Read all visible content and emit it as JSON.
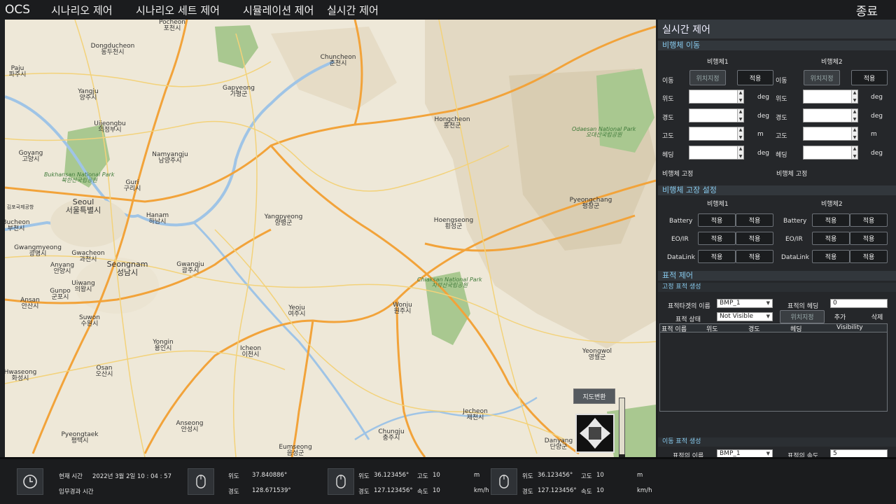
{
  "app": {
    "brand": "OCS",
    "menu": [
      "시나리오 제어",
      "시나리오 세트 제어",
      "시뮬레이션 제어",
      "실시간 제어"
    ],
    "quit": "종료"
  },
  "map": {
    "switch_label": "지도변환",
    "places": [
      {
        "en": "Pocheon",
        "ko": "포천시"
      },
      {
        "en": "Dongducheon",
        "ko": "동두천시"
      },
      {
        "en": "Chuncheon",
        "ko": "춘천시"
      },
      {
        "en": "Paju",
        "ko": "파주시"
      },
      {
        "en": "Yangju",
        "ko": "양주시"
      },
      {
        "en": "Gapyeong",
        "ko": "가평군"
      },
      {
        "en": "Uijeongbu",
        "ko": "의정부시"
      },
      {
        "en": "Hongcheon",
        "ko": "홍천군"
      },
      {
        "en": "Goyang",
        "ko": "고양시"
      },
      {
        "en": "Namyangju",
        "ko": "남양주시"
      },
      {
        "en": "Guri",
        "ko": "구리시"
      },
      {
        "en": "Seoul",
        "ko": "서울특별시"
      },
      {
        "en": "Pyeongchang",
        "ko": "평창군"
      },
      {
        "en": "Hanam",
        "ko": "하남시"
      },
      {
        "en": "Yangpyeong",
        "ko": "양평군"
      },
      {
        "en": "Hoengseong",
        "ko": "횡성군"
      },
      {
        "en": "Bucheon",
        "ko": "부천시"
      },
      {
        "en": "Gwangmyeong",
        "ko": "광명시"
      },
      {
        "en": "Gwacheon",
        "ko": "과천시"
      },
      {
        "en": "Seongnam",
        "ko": "성남시"
      },
      {
        "en": "Gwangju",
        "ko": "광주시"
      },
      {
        "en": "Anyang",
        "ko": "안양시"
      },
      {
        "en": "Uiwang",
        "ko": "의왕시"
      },
      {
        "en": "Gunpo",
        "ko": "군포시"
      },
      {
        "en": "Ansan",
        "ko": "안산시"
      },
      {
        "en": "Yeoju",
        "ko": "여주시"
      },
      {
        "en": "Wonju",
        "ko": "원주시"
      },
      {
        "en": "Suwon",
        "ko": "수원시"
      },
      {
        "en": "Yongin",
        "ko": "용인시"
      },
      {
        "en": "Icheon",
        "ko": "이천시"
      },
      {
        "en": "Osan",
        "ko": "오산시"
      },
      {
        "en": "Hwaseong",
        "ko": "화성시"
      },
      {
        "en": "Yeongwol",
        "ko": "영월군"
      },
      {
        "en": "Jecheon",
        "ko": "제천시"
      },
      {
        "en": "Anseong",
        "ko": "안성시"
      },
      {
        "en": "Pyeongtaek",
        "ko": "평택시"
      },
      {
        "en": "Chungju",
        "ko": "충주시"
      },
      {
        "en": "Danyang",
        "ko": "단양군"
      },
      {
        "en": "Eumseong",
        "ko": "음성군"
      }
    ],
    "parks": [
      {
        "en": "Bukhansan National Park",
        "ko": "북한산국립공원"
      },
      {
        "en": "Odaesan National Park",
        "ko": "오대산국립공원"
      },
      {
        "en": "Chiaksan National Park",
        "ko": "치악산국립공원"
      }
    ],
    "small_labels": [
      "김포국제공항",
      "Seoul"
    ]
  },
  "panel": {
    "title": "실시간 제어",
    "move": {
      "section": "비행체 이동",
      "vehicles": [
        "비행체1",
        "비행체2"
      ],
      "move_label": "이동",
      "position_btn": "위치지정",
      "apply_btn": "적용",
      "fields": [
        {
          "label": "위도",
          "unit": "deg"
        },
        {
          "label": "경도",
          "unit": "deg"
        },
        {
          "label": "고도",
          "unit": "m"
        },
        {
          "label": "헤딩",
          "unit": "deg"
        }
      ],
      "fix_label": "비행체 고정"
    },
    "fault": {
      "section": "비행체 고장 설정",
      "vehicles": [
        "비행체1",
        "비행체2"
      ],
      "rows": [
        "Battery",
        "EO/IR",
        "DataLink"
      ],
      "btn": "적용"
    },
    "target": {
      "section": "표적 제어",
      "fixed_sub": "고정 표적 생성",
      "name_label": "표적타겟의 이름",
      "name_value": "BMP_1",
      "heading_label": "표적의 헤딩",
      "heading_value": "0",
      "state_label": "표적 상태",
      "state_value": "Not Visible",
      "position_btn": "위치지정",
      "add_btn": "추가",
      "delete_btn": "삭제",
      "columns": [
        "표적 이름",
        "위도",
        "경도",
        "헤딩",
        "Visibility"
      ],
      "moving_sub": "이동 표적 생성",
      "moving_name_label": "표적의 이름",
      "moving_name_value": "BMP_1",
      "speed_label": "표적의 속도",
      "speed_value": "5"
    }
  },
  "status": {
    "time_label": "현재 시간",
    "time_value": "2022년 3월 2일  10 : 04 : 57",
    "mission_label": "임무경과 시간",
    "cursor": {
      "lat_label": "위도",
      "lat": "37.840886°",
      "lon_label": "경도",
      "lon": "128.671539°"
    },
    "uav1": {
      "lat_label": "위도",
      "lat": "36.123456°",
      "alt_label": "고도",
      "alt": "10",
      "alt_unit": "m",
      "lon_label": "경도",
      "lon": "127.123456°",
      "spd_label": "속도",
      "spd": "10",
      "spd_unit": "km/h"
    },
    "uav2": {
      "lat_label": "위도",
      "lat": "36.123456°",
      "alt_label": "고도",
      "alt": "10",
      "alt_unit": "m",
      "lon_label": "경도",
      "lon": "127.123456°",
      "spd_label": "속도",
      "spd": "10",
      "spd_unit": "km/h"
    }
  }
}
